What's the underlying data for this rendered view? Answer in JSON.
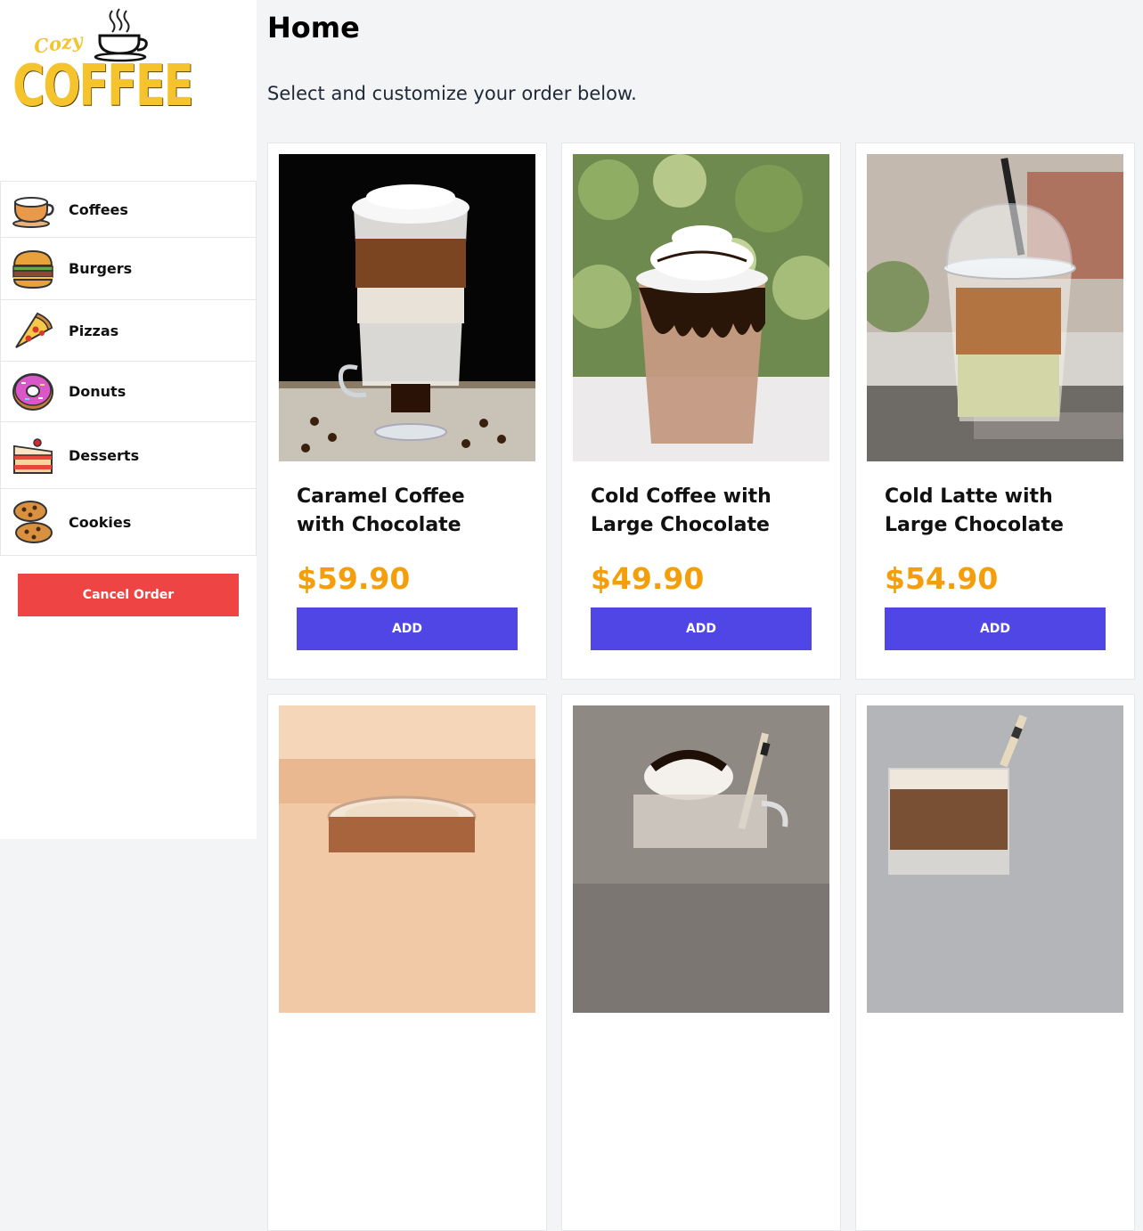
{
  "brand": {
    "small": "Cozy",
    "large": "COFFEE"
  },
  "menu": [
    {
      "label": "Coffees",
      "icon": "coffee-cup-icon"
    },
    {
      "label": "Burgers",
      "icon": "burger-icon"
    },
    {
      "label": "Pizzas",
      "icon": "pizza-icon"
    },
    {
      "label": "Donuts",
      "icon": "donut-icon"
    },
    {
      "label": "Desserts",
      "icon": "cake-icon"
    },
    {
      "label": "Cookies",
      "icon": "cookie-icon"
    }
  ],
  "cancel_label": "Cancel Order",
  "page": {
    "title": "Home",
    "subtitle": "Select and customize your order below."
  },
  "products": [
    {
      "name": "Caramel Coffee with Chocolate",
      "price": "$59.90",
      "add_label": "ADD"
    },
    {
      "name": "Cold Coffee with Large Chocolate",
      "price": "$49.90",
      "add_label": "ADD"
    },
    {
      "name": "Cold Latte with Large Chocolate",
      "price": "$54.90",
      "add_label": "ADD"
    }
  ],
  "colors": {
    "accent": "#4f46e5",
    "danger": "#ef4444",
    "price": "#f59e0b",
    "brand": "#f5c42c"
  }
}
